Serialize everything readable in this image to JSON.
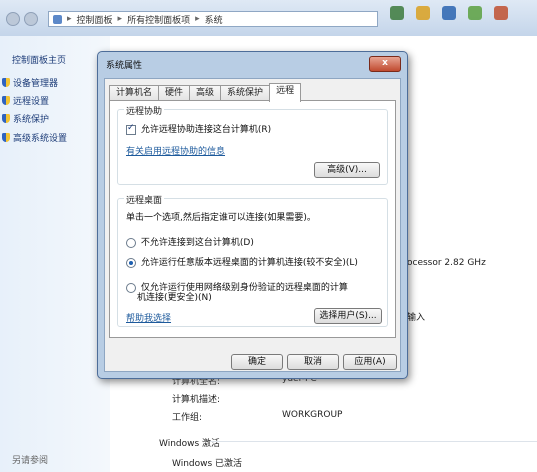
{
  "address_bar": {
    "breadcrumbs": [
      "控制面板",
      "所有控制面板项",
      "系统"
    ]
  },
  "sidebar": {
    "title": "控制面板主页",
    "items": [
      {
        "label": "设备管理器"
      },
      {
        "label": "远程设置"
      },
      {
        "label": "系统保护"
      },
      {
        "label": "高级系统设置"
      }
    ],
    "see_also": "另请参阅"
  },
  "background": {
    "processor_text": "ocessor  2.82 GHz",
    "input_text": "输入",
    "computer_name_label": "计算机全名:",
    "computer_name_value": "yuer-PC",
    "computer_desc_label": "计算机描述:",
    "workgroup_label": "工作组:",
    "workgroup_value": "WORKGROUP",
    "activation_heading": "Windows 激活",
    "activation_status": "Windows 已激活"
  },
  "dialog": {
    "title": "系统属性",
    "close_label": "x",
    "tabs": [
      {
        "label": "计算机名"
      },
      {
        "label": "硬件"
      },
      {
        "label": "高级"
      },
      {
        "label": "系统保护"
      },
      {
        "label": "远程"
      }
    ],
    "remote_assistance": {
      "group_label": "远程协助",
      "checkbox_label": "允许远程协助连接这台计算机(R)",
      "checked": true,
      "link_label": "有关启用远程协助的信息",
      "advanced_button": "高级(V)..."
    },
    "remote_desktop": {
      "group_label": "远程桌面",
      "instruction": "单击一个选项,然后指定谁可以连接(如果需要)。",
      "options": [
        {
          "label": "不允许连接到这台计算机(D)",
          "selected": false
        },
        {
          "label": "允许运行任意版本远程桌面的计算机连接(较不安全)(L)",
          "selected": true
        },
        {
          "label_line1": "仅允许运行使用网络级别身份验证的远程桌面的计算",
          "label_line2": "机连接(更安全)(N)",
          "selected": false
        }
      ],
      "help_link": "帮助我选择",
      "select_users_button": "选择用户(S)..."
    },
    "buttons": {
      "ok": "确定",
      "cancel": "取消",
      "apply": "应用(A)"
    }
  }
}
